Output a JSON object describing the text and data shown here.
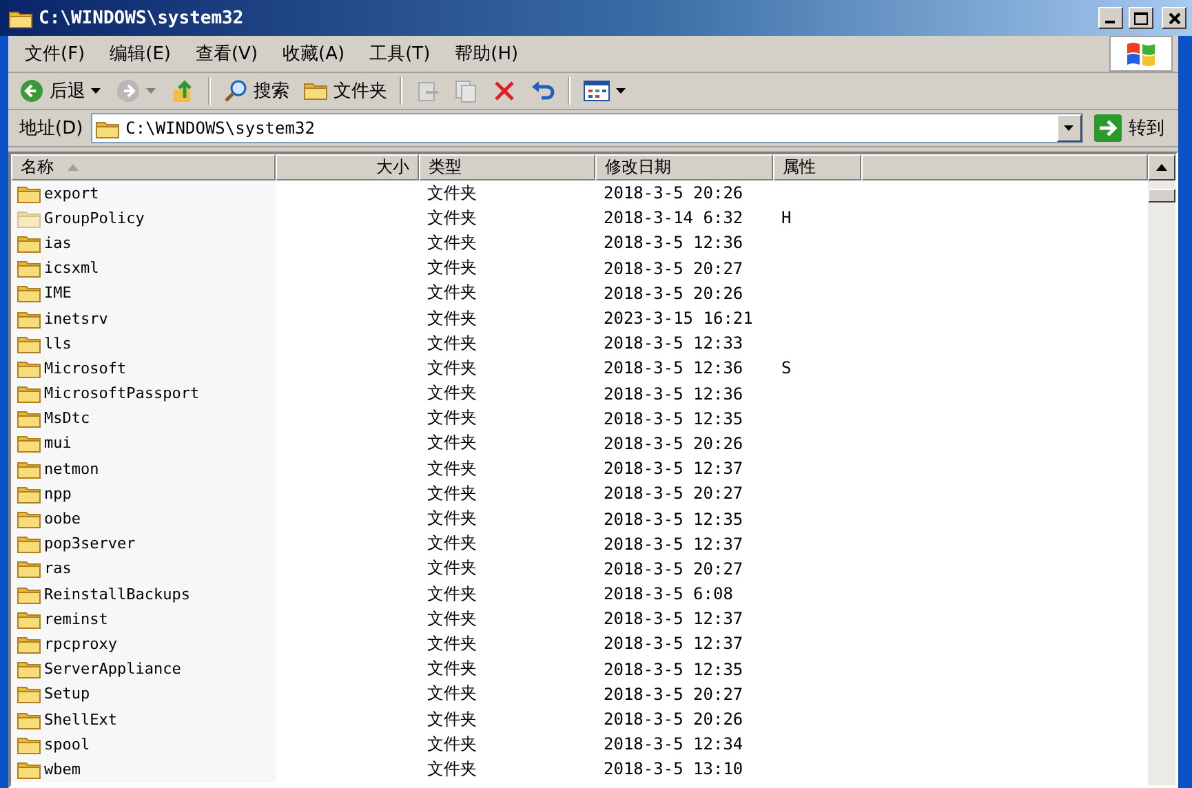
{
  "window": {
    "title": "C:\\WINDOWS\\system32"
  },
  "menu": [
    "文件(F)",
    "编辑(E)",
    "查看(V)",
    "收藏(A)",
    "工具(T)",
    "帮助(H)"
  ],
  "toolbar": {
    "back": "后退",
    "search": "搜索",
    "folders": "文件夹"
  },
  "address": {
    "label": "地址(D)",
    "value": "C:\\WINDOWS\\system32",
    "go": "转到"
  },
  "columns": [
    {
      "label": "名称",
      "sorted": true
    },
    {
      "label": "大小",
      "sorted": false
    },
    {
      "label": "类型",
      "sorted": false
    },
    {
      "label": "修改日期",
      "sorted": false
    },
    {
      "label": "属性",
      "sorted": false
    }
  ],
  "rows": [
    {
      "name": "export",
      "type": "文件夹",
      "date": "2018-3-5 20:26",
      "attr": "",
      "hidden": false
    },
    {
      "name": "GroupPolicy",
      "type": "文件夹",
      "date": "2018-3-14 6:32",
      "attr": "H",
      "hidden": true
    },
    {
      "name": "ias",
      "type": "文件夹",
      "date": "2018-3-5 12:36",
      "attr": "",
      "hidden": false
    },
    {
      "name": "icsxml",
      "type": "文件夹",
      "date": "2018-3-5 20:27",
      "attr": "",
      "hidden": false
    },
    {
      "name": "IME",
      "type": "文件夹",
      "date": "2018-3-5 20:26",
      "attr": "",
      "hidden": false
    },
    {
      "name": "inetsrv",
      "type": "文件夹",
      "date": "2023-3-15 16:21",
      "attr": "",
      "hidden": false
    },
    {
      "name": "lls",
      "type": "文件夹",
      "date": "2018-3-5 12:33",
      "attr": "",
      "hidden": false
    },
    {
      "name": "Microsoft",
      "type": "文件夹",
      "date": "2018-3-5 12:36",
      "attr": "S",
      "hidden": false
    },
    {
      "name": "MicrosoftPassport",
      "type": "文件夹",
      "date": "2018-3-5 12:36",
      "attr": "",
      "hidden": false
    },
    {
      "name": "MsDtc",
      "type": "文件夹",
      "date": "2018-3-5 12:35",
      "attr": "",
      "hidden": false
    },
    {
      "name": "mui",
      "type": "文件夹",
      "date": "2018-3-5 20:26",
      "attr": "",
      "hidden": false
    },
    {
      "name": "netmon",
      "type": "文件夹",
      "date": "2018-3-5 12:37",
      "attr": "",
      "hidden": false
    },
    {
      "name": "npp",
      "type": "文件夹",
      "date": "2018-3-5 20:27",
      "attr": "",
      "hidden": false
    },
    {
      "name": "oobe",
      "type": "文件夹",
      "date": "2018-3-5 12:35",
      "attr": "",
      "hidden": false
    },
    {
      "name": "pop3server",
      "type": "文件夹",
      "date": "2018-3-5 12:37",
      "attr": "",
      "hidden": false
    },
    {
      "name": "ras",
      "type": "文件夹",
      "date": "2018-3-5 20:27",
      "attr": "",
      "hidden": false
    },
    {
      "name": "ReinstallBackups",
      "type": "文件夹",
      "date": "2018-3-5 6:08",
      "attr": "",
      "hidden": false
    },
    {
      "name": "reminst",
      "type": "文件夹",
      "date": "2018-3-5 12:37",
      "attr": "",
      "hidden": false
    },
    {
      "name": "rpcproxy",
      "type": "文件夹",
      "date": "2018-3-5 12:37",
      "attr": "",
      "hidden": false
    },
    {
      "name": "ServerAppliance",
      "type": "文件夹",
      "date": "2018-3-5 12:35",
      "attr": "",
      "hidden": false
    },
    {
      "name": "Setup",
      "type": "文件夹",
      "date": "2018-3-5 20:27",
      "attr": "",
      "hidden": false
    },
    {
      "name": "ShellExt",
      "type": "文件夹",
      "date": "2018-3-5 20:26",
      "attr": "",
      "hidden": false
    },
    {
      "name": "spool",
      "type": "文件夹",
      "date": "2018-3-5 12:34",
      "attr": "",
      "hidden": false
    },
    {
      "name": "wbem",
      "type": "文件夹",
      "date": "2018-3-5 13:10",
      "attr": "",
      "hidden": false
    }
  ]
}
